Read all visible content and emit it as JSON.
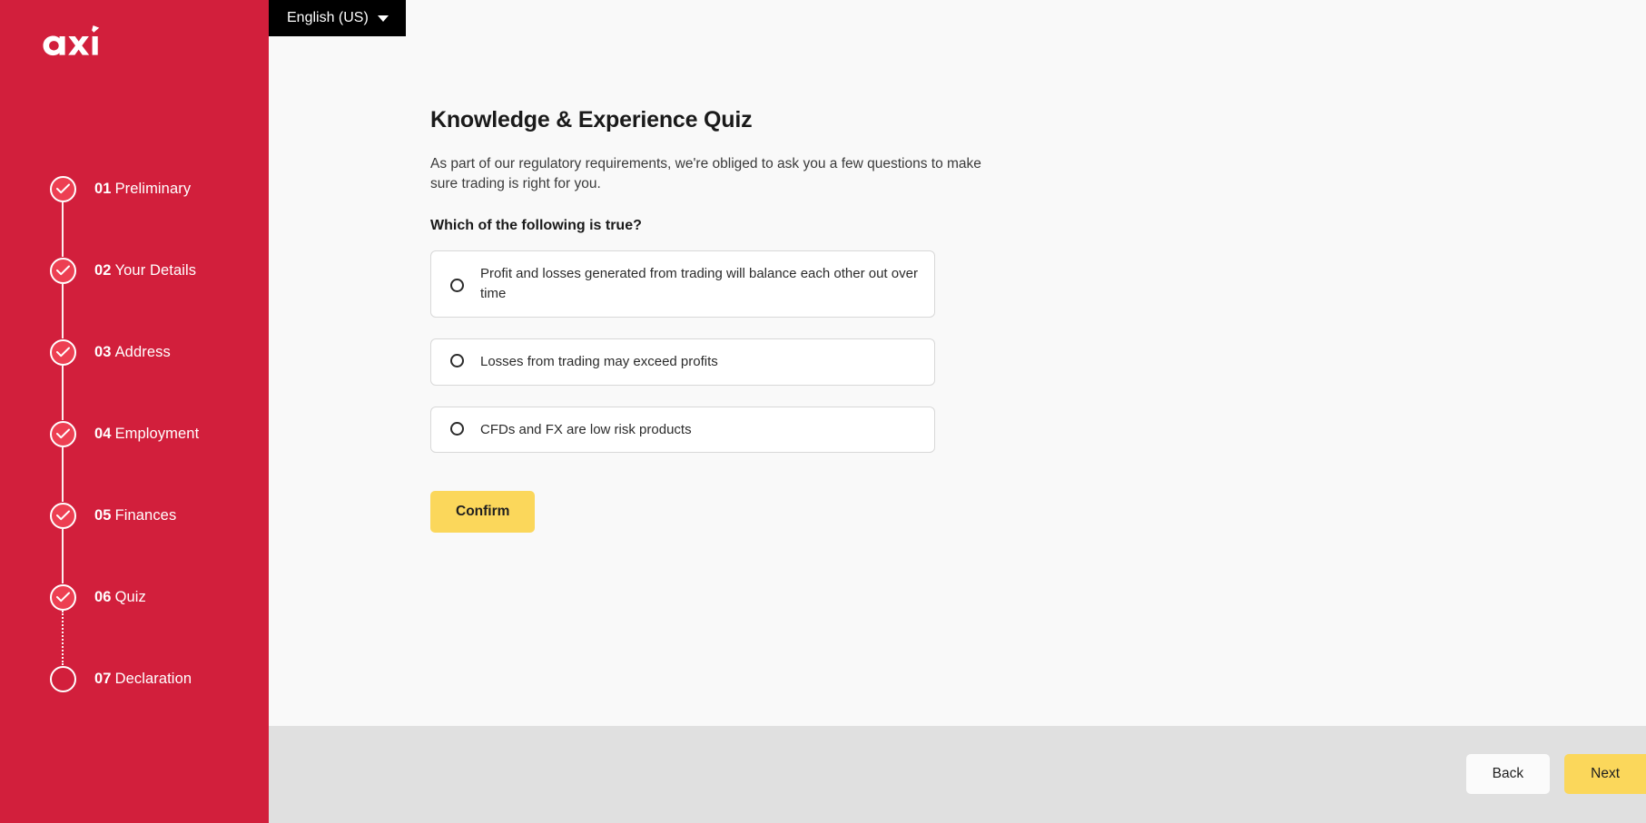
{
  "brand": {
    "logo_text": "axi",
    "sidebar_color": "#d21f3c",
    "accent_color": "#fbd75b"
  },
  "header": {
    "language_label": "English (US)",
    "language_icon": "chevron-down-icon"
  },
  "sidebar": {
    "steps": [
      {
        "number": "01",
        "name": "Preliminary",
        "state": "done",
        "connector": "solid"
      },
      {
        "number": "02",
        "name": "Your Details",
        "state": "done",
        "connector": "solid"
      },
      {
        "number": "03",
        "name": "Address",
        "state": "done",
        "connector": "solid"
      },
      {
        "number": "04",
        "name": "Employment",
        "state": "done",
        "connector": "solid"
      },
      {
        "number": "05",
        "name": "Finances",
        "state": "done",
        "connector": "solid"
      },
      {
        "number": "06",
        "name": "Quiz",
        "state": "done",
        "connector": "dotted"
      },
      {
        "number": "07",
        "name": "Declaration",
        "state": "pending",
        "connector": "none"
      }
    ]
  },
  "main": {
    "title": "Knowledge & Experience Quiz",
    "description": "As part of our regulatory requirements, we're obliged to ask you a few questions to make sure trading is right for you.",
    "question": "Which of the following is true?",
    "options": [
      {
        "label": "Profit and losses generated from trading will balance each other out over time",
        "selected": false
      },
      {
        "label": "Losses from trading may exceed profits",
        "selected": false
      },
      {
        "label": "CFDs and FX are low risk products",
        "selected": false
      }
    ],
    "confirm_label": "Confirm"
  },
  "footer": {
    "back_label": "Back",
    "next_label": "Next"
  }
}
